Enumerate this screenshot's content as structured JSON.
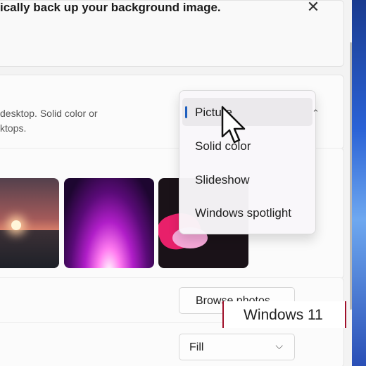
{
  "banner": {
    "text": "ically back up your background image."
  },
  "personalize_card": {
    "description_line1": "desktop. Solid color or",
    "description_line2": "ktops."
  },
  "dropdown": {
    "items": [
      {
        "label": "Picture",
        "selected": true
      },
      {
        "label": "Solid color",
        "selected": false
      },
      {
        "label": "Slideshow",
        "selected": false
      },
      {
        "label": "Windows spotlight",
        "selected": false
      }
    ]
  },
  "browse": {
    "label": "Browse photos"
  },
  "fit": {
    "value": "Fill"
  },
  "overlay": {
    "text": "Windows 11"
  },
  "icons": {
    "close": "close-icon",
    "cursor": "mouse-pointer-icon",
    "chevron": "chevron-down-icon"
  },
  "colors": {
    "accent": "#1f5fbf",
    "overlay_border": "#a0102a"
  }
}
